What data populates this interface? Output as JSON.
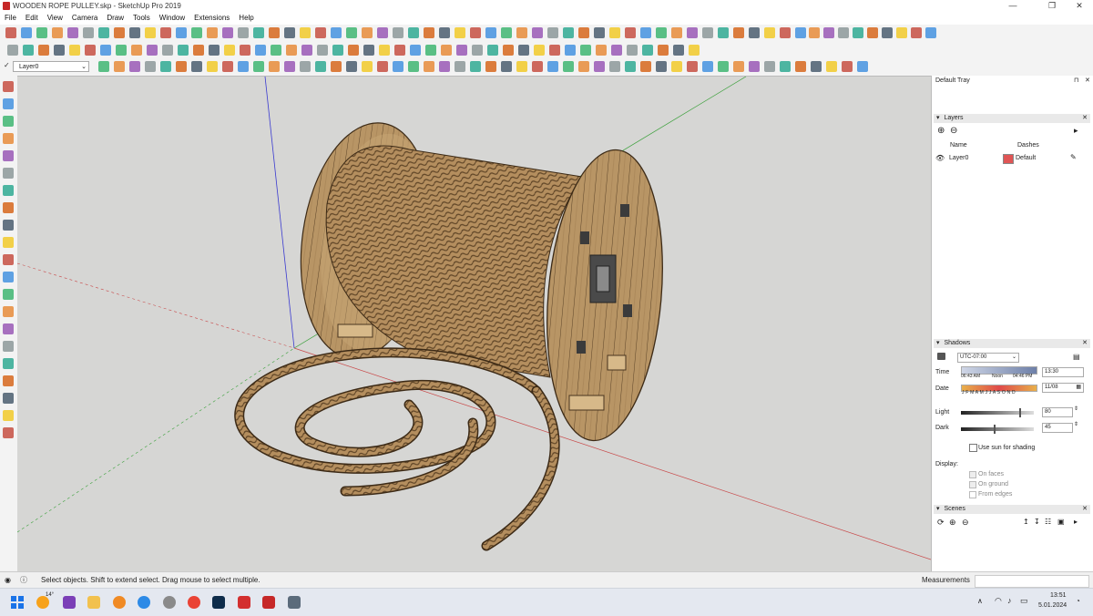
{
  "window": {
    "title": "WOODEN ROPE PULLEY.skp - SketchUp Pro 2019",
    "minimize": "—",
    "maximize": "❐",
    "close": "✕"
  },
  "menu": [
    "File",
    "Edit",
    "View",
    "Camera",
    "Draw",
    "Tools",
    "Window",
    "Extensions",
    "Help"
  ],
  "layer_select": {
    "value": "Layer0"
  },
  "tray": {
    "title": "Default Tray",
    "layers": {
      "header": "Layers",
      "col_name": "Name",
      "col_dashes": "Dashes",
      "row": {
        "name": "Layer0",
        "dashes": "Default",
        "color": "#e05555"
      }
    },
    "shadows": {
      "header": "Shadows",
      "timezone": "UTC-07:00",
      "time_label": "Time",
      "sunrise": "06:43 AM",
      "noon": "Noon",
      "sunset": "04:46 PM",
      "time_value": "13:30",
      "date_label": "Date",
      "months": "J F M A M J J A S O N D",
      "date_value": "11/08",
      "light_label": "Light",
      "light_value": "80",
      "light_level": 80,
      "dark_label": "Dark",
      "dark_value": "45",
      "dark_level": 45,
      "use_sun": "Use sun for shading",
      "display_label": "Display:",
      "on_faces": "On faces",
      "on_ground": "On ground",
      "from_edges": "From edges"
    },
    "scenes": {
      "header": "Scenes"
    }
  },
  "status": {
    "message": "Select objects. Shift to extend select. Drag mouse to select multiple.",
    "measurements_label": "Measurements"
  },
  "taskbar": {
    "weather": "14°",
    "time": "13:51",
    "date": "5.01.2024"
  }
}
